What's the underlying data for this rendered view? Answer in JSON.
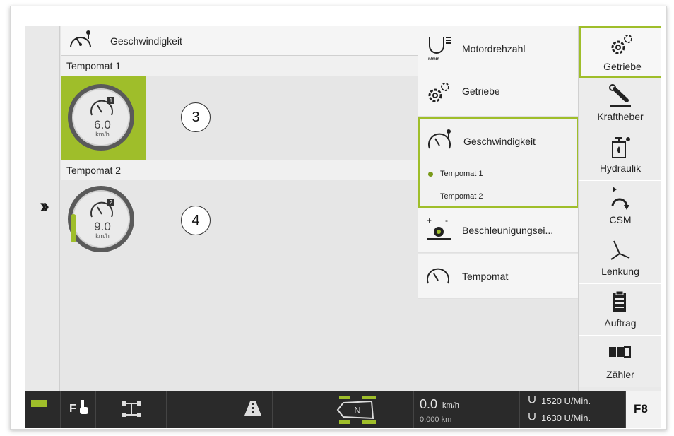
{
  "header": {
    "title": "Geschwindigkeit",
    "icon": "speedometer-pin-icon"
  },
  "main": {
    "sections": [
      {
        "label": "Tempomat 1",
        "value": "6.0",
        "unit": "km/h",
        "badge": "1",
        "callout": "3",
        "active": true
      },
      {
        "label": "Tempomat 2",
        "value": "9.0",
        "unit": "km/h",
        "badge": "2",
        "callout": "4",
        "active": false
      }
    ]
  },
  "menu": {
    "items": [
      {
        "label": "Motordrehzahl",
        "icon": "engine-rpm-icon",
        "unit": "n/min"
      },
      {
        "label": "Getriebe",
        "icon": "gears-icon"
      },
      {
        "label": "Geschwindigkeit",
        "icon": "speedometer-pin-icon",
        "subitems": [
          "Tempomat 1",
          "Tempomat 2"
        ]
      },
      {
        "label": "Beschleunigungsei...",
        "icon": "acceleration-icon"
      },
      {
        "label": "Tempomat",
        "icon": "speedometer-icon"
      }
    ]
  },
  "tabs": [
    {
      "label": "Getriebe",
      "icon": "gears-icon",
      "active": true
    },
    {
      "label": "Kraftheber",
      "icon": "hitch-icon"
    },
    {
      "label": "Hydraulik",
      "icon": "hydraulic-icon"
    },
    {
      "label": "CSM",
      "icon": "csm-turn-icon"
    },
    {
      "label": "Lenkung",
      "icon": "steering-icon"
    },
    {
      "label": "Auftrag",
      "icon": "clipboard-icon"
    },
    {
      "label": "Zähler",
      "icon": "counter-icon"
    }
  ],
  "statusbar": {
    "f_label": "F",
    "speed": "0.0",
    "speed_unit": "km/h",
    "distance": "0.000 km",
    "rpm1": "1520 U/Min.",
    "rpm2": "1630 U/Min.",
    "gear": "N",
    "f8": "F8"
  },
  "colors": {
    "accent": "#9fbe2a",
    "statusbar": "#2a2a2a"
  }
}
